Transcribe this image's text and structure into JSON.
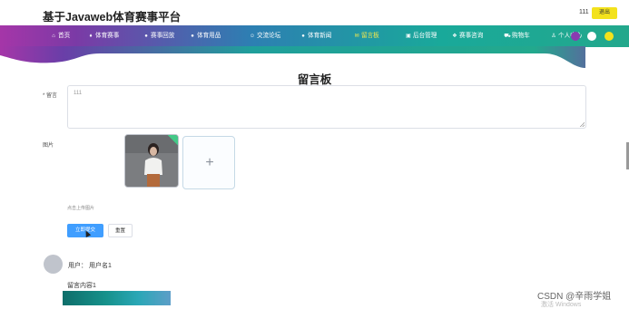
{
  "header": {
    "site_title": "基于Javaweb体育赛事平台",
    "user": "111",
    "logout_label": "退出"
  },
  "nav": {
    "items": [
      {
        "label": "首页",
        "icon": "home-icon",
        "glyph": "⌂"
      },
      {
        "label": "体育赛事",
        "icon": "trophy-icon",
        "glyph": "♦"
      },
      {
        "label": "赛事回放",
        "icon": "play-icon",
        "glyph": "●"
      },
      {
        "label": "体育用品",
        "icon": "box-icon",
        "glyph": "●"
      },
      {
        "label": "交流论坛",
        "icon": "chat-icon",
        "glyph": "☺"
      },
      {
        "label": "体育新闻",
        "icon": "news-icon",
        "glyph": "●"
      },
      {
        "label": "留言板",
        "icon": "message-icon",
        "glyph": "✉",
        "active": true
      },
      {
        "label": "后台管理",
        "icon": "admin-icon",
        "glyph": "▣"
      },
      {
        "label": "赛事咨询",
        "icon": "info-icon",
        "glyph": "❖"
      },
      {
        "label": "购物车",
        "icon": "cart-icon",
        "glyph": "⛟"
      },
      {
        "label": "个人中心",
        "icon": "user-icon",
        "glyph": "♙"
      }
    ]
  },
  "page": {
    "title": "留言板"
  },
  "form": {
    "message_label": "* 留言",
    "message_value": "111",
    "image_label": "图片",
    "upload_hint": "点击上传图片",
    "submit_label": "立即提交",
    "reset_label": "重置"
  },
  "comment": {
    "user_line": "用户：  用户名1",
    "content": "留言内容1"
  },
  "watermark": {
    "csdn": "CSDN @辛雨学姐",
    "windows": "激活 Windows"
  },
  "colors": {
    "accent": "#409eff",
    "logout": "#f3e21c",
    "nav_active": "#f7e94a"
  }
}
